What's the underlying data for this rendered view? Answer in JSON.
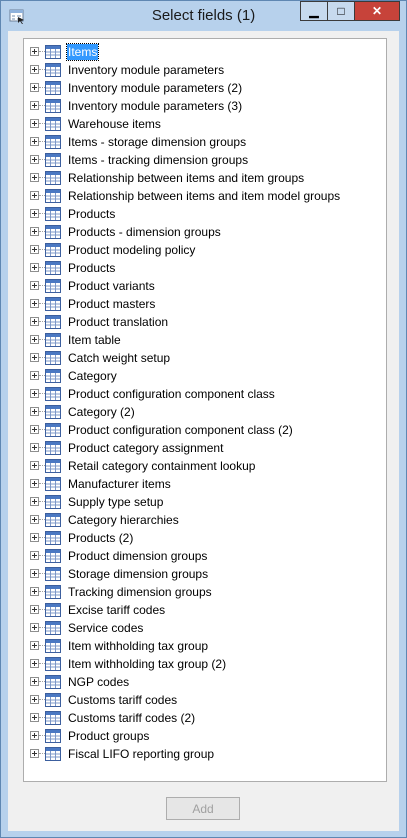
{
  "window": {
    "title": "Select fields (1)",
    "controls": {
      "minimize": "▁",
      "maximize": "□",
      "close": "✕"
    },
    "accent_color": "#b7d1ec",
    "close_color": "#c7433a"
  },
  "tree": {
    "selected_index": 0,
    "items": [
      {
        "label": "Items",
        "icon": "table-icon"
      },
      {
        "label": "Inventory module parameters",
        "icon": "table-icon"
      },
      {
        "label": "Inventory module parameters (2)",
        "icon": "table-icon"
      },
      {
        "label": "Inventory module parameters (3)",
        "icon": "table-icon"
      },
      {
        "label": "Warehouse items",
        "icon": "table-icon"
      },
      {
        "label": "Items - storage dimension groups",
        "icon": "table-icon"
      },
      {
        "label": "Items - tracking dimension groups",
        "icon": "table-icon"
      },
      {
        "label": "Relationship between items and item groups",
        "icon": "table-icon"
      },
      {
        "label": "Relationship between items and item model groups",
        "icon": "table-icon"
      },
      {
        "label": "Products",
        "icon": "table-icon"
      },
      {
        "label": "Products - dimension groups",
        "icon": "table-icon"
      },
      {
        "label": "Product modeling policy",
        "icon": "table-icon"
      },
      {
        "label": "Products",
        "icon": "table-icon"
      },
      {
        "label": "Product variants",
        "icon": "table-icon"
      },
      {
        "label": "Product masters",
        "icon": "table-icon"
      },
      {
        "label": "Product translation",
        "icon": "table-icon"
      },
      {
        "label": "Item table",
        "icon": "table-icon"
      },
      {
        "label": "Catch weight setup",
        "icon": "table-icon"
      },
      {
        "label": "Category",
        "icon": "table-icon"
      },
      {
        "label": "Product configuration component class",
        "icon": "table-icon"
      },
      {
        "label": "Category (2)",
        "icon": "table-icon"
      },
      {
        "label": "Product configuration component class (2)",
        "icon": "table-icon"
      },
      {
        "label": "Product category assignment",
        "icon": "table-icon"
      },
      {
        "label": "Retail category containment lookup",
        "icon": "table-icon"
      },
      {
        "label": "Manufacturer items",
        "icon": "table-icon"
      },
      {
        "label": "Supply type setup",
        "icon": "table-icon"
      },
      {
        "label": "Category hierarchies",
        "icon": "table-icon"
      },
      {
        "label": "Products (2)",
        "icon": "table-icon"
      },
      {
        "label": "Product dimension groups",
        "icon": "table-icon"
      },
      {
        "label": "Storage dimension groups",
        "icon": "table-icon"
      },
      {
        "label": "Tracking dimension groups",
        "icon": "table-icon"
      },
      {
        "label": "Excise tariff codes",
        "icon": "table-icon"
      },
      {
        "label": "Service codes",
        "icon": "table-icon"
      },
      {
        "label": "Item withholding tax group",
        "icon": "table-icon"
      },
      {
        "label": "Item withholding tax group (2)",
        "icon": "table-icon"
      },
      {
        "label": "NGP codes",
        "icon": "table-icon"
      },
      {
        "label": "Customs tariff codes",
        "icon": "table-icon"
      },
      {
        "label": "Customs tariff codes (2)",
        "icon": "table-icon"
      },
      {
        "label": "Product groups",
        "icon": "table-icon"
      },
      {
        "label": "Fiscal LIFO reporting group",
        "icon": "table-icon"
      }
    ]
  },
  "footer": {
    "add_label": "Add",
    "add_enabled": false
  }
}
